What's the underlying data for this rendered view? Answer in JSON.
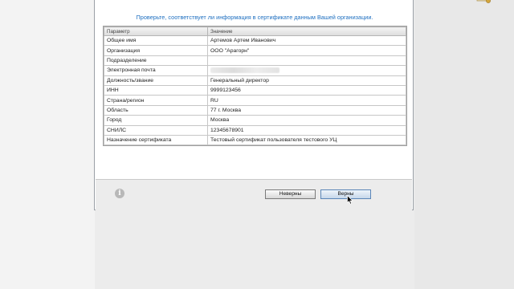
{
  "notice": "Проверьте, соответствует ли информация в сертификате данным Вашей организации.",
  "table": {
    "headers": [
      "Параметр",
      "Значение"
    ],
    "rows": [
      [
        "Общее имя",
        "Артемов Артем Иванович"
      ],
      [
        "Организация",
        "ООО \"Арагорн\""
      ],
      [
        "Подразделение",
        ""
      ],
      [
        "Электронная почта",
        ""
      ],
      [
        "Должность/звание",
        "Генеральный директор"
      ],
      [
        "ИНН",
        "9999123456"
      ],
      [
        "Страна/регион",
        "RU"
      ],
      [
        "Область",
        "77 г. Москва"
      ],
      [
        "Город",
        "Москва"
      ],
      [
        "СНИЛС",
        "12345678901"
      ],
      [
        "Назначение сертификата",
        "Тестовый сертификат пользователя тестового УЦ"
      ]
    ]
  },
  "buttons": {
    "wrong": "Неверны",
    "correct": "Верны"
  },
  "icons": {
    "info": "info-icon",
    "top_decoration": "certificate-seal-icon",
    "cursor": "mouse-cursor-icon"
  },
  "colors": {
    "notice_text": "#1e6fc0",
    "footer_bg": "#ececec"
  }
}
